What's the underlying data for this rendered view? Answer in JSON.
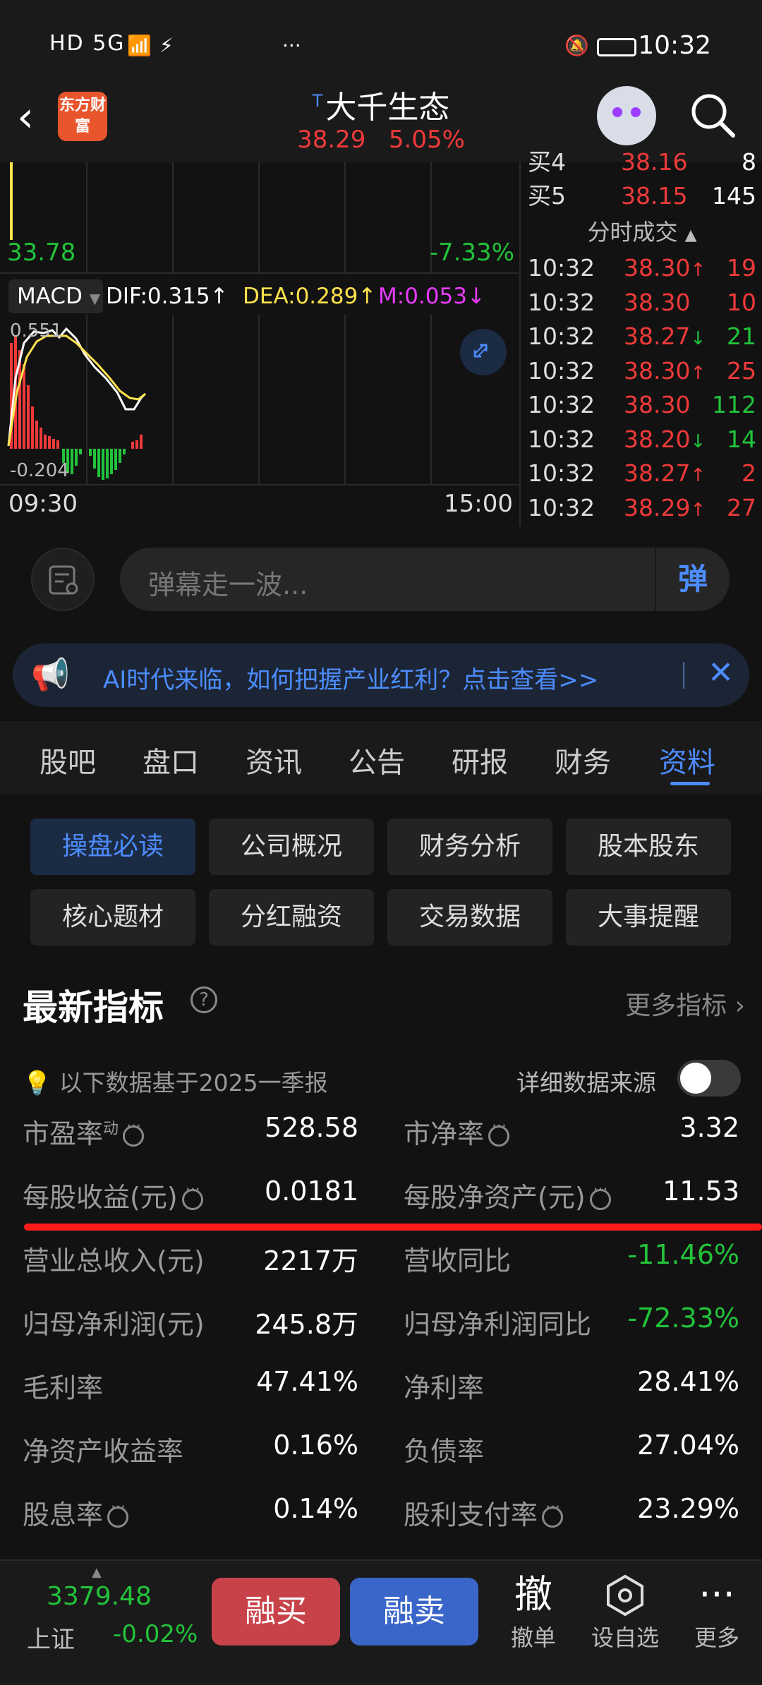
{
  "status_bar": {
    "left": "HD 5G",
    "time": "10:32"
  },
  "header": {
    "back": "‹",
    "logo": "东方财富",
    "title_prefix": "T",
    "title": "大千生态",
    "price": "38.29",
    "change_pct": "5.05%"
  },
  "chart": {
    "low_price": "33.78",
    "low_pct": "-7.33%",
    "macd_label": "MACD",
    "dif": "DIF:0.315",
    "dea": "DEA:0.289",
    "m": "M:0.053",
    "macd_top": "0.551",
    "macd_bottom": "-0.204",
    "time_start": "09:30",
    "time_end": "15:00",
    "colors": {
      "dif": "#ffffff",
      "dea": "#ffe34d",
      "m": "#e83cff",
      "up": "#f03a3a",
      "down": "#22c33a"
    }
  },
  "order_book": {
    "top_partial": {
      "label": "买4",
      "price": "38.16",
      "vol": "8"
    },
    "buy5": {
      "label": "买5",
      "price": "38.15",
      "vol": "145"
    },
    "section_title": "分时成交",
    "trades": [
      {
        "time": "10:32",
        "price": "38.30",
        "arrow": "↑",
        "vol": "19",
        "vol_color": "up"
      },
      {
        "time": "10:32",
        "price": "38.30",
        "arrow": "",
        "vol": "10",
        "vol_color": "up"
      },
      {
        "time": "10:32",
        "price": "38.27",
        "arrow": "↓",
        "vol": "21",
        "vol_color": "down"
      },
      {
        "time": "10:32",
        "price": "38.30",
        "arrow": "↑",
        "vol": "25",
        "vol_color": "up"
      },
      {
        "time": "10:32",
        "price": "38.30",
        "arrow": "",
        "vol": "112",
        "vol_color": "down"
      },
      {
        "time": "10:32",
        "price": "38.20",
        "arrow": "↓",
        "vol": "14",
        "vol_color": "down"
      },
      {
        "time": "10:32",
        "price": "38.27",
        "arrow": "↑",
        "vol": "2",
        "vol_color": "up"
      },
      {
        "time": "10:32",
        "price": "38.29",
        "arrow": "↑",
        "vol": "27",
        "vol_color": "up"
      }
    ]
  },
  "danmu": {
    "placeholder": "弹幕走一波...",
    "send": "弹"
  },
  "banner": {
    "text": "AI时代来临，如何把握产业红利？点击查看>>",
    "close": "✕"
  },
  "tabs": [
    "股吧",
    "盘口",
    "资讯",
    "公告",
    "研报",
    "财务",
    "资料"
  ],
  "sub_buttons": [
    "操盘必读",
    "公司概况",
    "财务分析",
    "股本股东",
    "核心题材",
    "分红融资",
    "交易数据",
    "大事提醒"
  ],
  "metrics": {
    "title": "最新指标",
    "more": "更多指标 ›",
    "note": "以下数据基于2025一季报",
    "source": "详细数据来源",
    "rows": [
      {
        "l1": "市盈率",
        "sup": "动",
        "d1": true,
        "v1": "528.58",
        "c1": "",
        "l2": "市净率",
        "d2": true,
        "v2": "3.32",
        "c2": ""
      },
      {
        "l1": "每股收益(元)",
        "sup": "",
        "d1": true,
        "v1": "0.0181",
        "c1": "",
        "l2": "每股净资产(元)",
        "d2": true,
        "v2": "11.53",
        "c2": ""
      },
      {
        "l1": "营业总收入(元)",
        "sup": "",
        "d1": false,
        "v1": "2217万",
        "c1": "",
        "l2": "营收同比",
        "d2": false,
        "v2": "-11.46%",
        "c2": "neg"
      },
      {
        "l1": "归母净利润(元)",
        "sup": "",
        "d1": false,
        "v1": "245.8万",
        "c1": "",
        "l2": "归母净利润同比",
        "d2": false,
        "v2": "-72.33%",
        "c2": "neg"
      },
      {
        "l1": "毛利率",
        "sup": "",
        "d1": false,
        "v1": "47.41%",
        "c1": "",
        "l2": "净利率",
        "d2": false,
        "v2": "28.41%",
        "c2": ""
      },
      {
        "l1": "净资产收益率",
        "sup": "",
        "d1": false,
        "v1": "0.16%",
        "c1": "",
        "l2": "负债率",
        "d2": false,
        "v2": "27.04%",
        "c2": ""
      },
      {
        "l1": "股息率",
        "sup": "",
        "d1": true,
        "v1": "0.14%",
        "c1": "",
        "l2": "股利支付率",
        "d2": true,
        "v2": "23.29%",
        "c2": ""
      }
    ]
  },
  "bottom_bar": {
    "index_value": "3379.48",
    "index_name": "上证",
    "index_change": "-0.02%",
    "buy_btn": "融买",
    "sell_btn": "融卖",
    "cancel_icon": "撤",
    "cancel": "撤单",
    "watch": "设自选",
    "more": "更多",
    "colors": {
      "buy": "#c8424a",
      "sell": "#3a66c9"
    }
  }
}
